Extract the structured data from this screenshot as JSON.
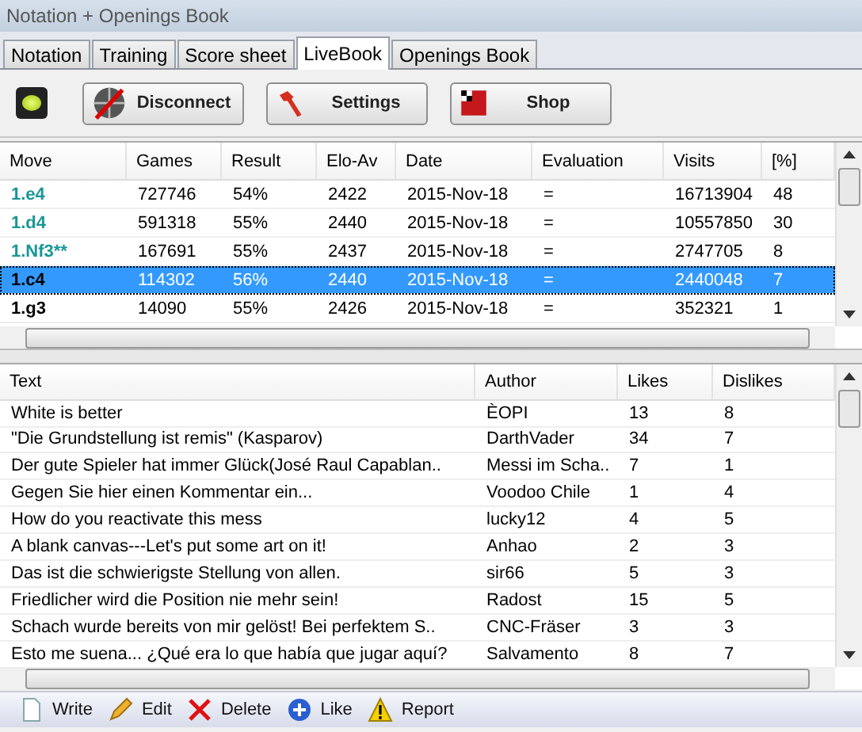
{
  "window": {
    "title": "Notation + Openings Book"
  },
  "tabs": [
    {
      "label": "Notation",
      "selected": false
    },
    {
      "label": "Training",
      "selected": false
    },
    {
      "label": "Score sheet",
      "selected": false
    },
    {
      "label": "LiveBook",
      "selected": true
    },
    {
      "label": "Openings Book",
      "selected": false
    }
  ],
  "toolbar": {
    "connected": true,
    "buttons": [
      {
        "kind": "disconnect",
        "label": "Disconnect"
      },
      {
        "kind": "settings",
        "label": "Settings"
      },
      {
        "kind": "shop",
        "label": "Shop"
      }
    ]
  },
  "moves_table": {
    "columns": [
      "Move",
      "Games",
      "Result",
      "Elo-Av",
      "Date",
      "Evaluation",
      "Visits",
      "[%]"
    ],
    "rows": [
      {
        "cells": [
          "1.e4",
          "727746",
          "54%",
          "2422",
          "2015-Nov-18",
          "=",
          "16713904",
          "48"
        ],
        "color": "#1a9696",
        "selected": false
      },
      {
        "cells": [
          "1.d4",
          "591318",
          "55%",
          "2440",
          "2015-Nov-18",
          "=",
          "10557850",
          "30"
        ],
        "color": "#1a9696",
        "selected": false
      },
      {
        "cells": [
          "1.Nf3**",
          "167691",
          "55%",
          "2437",
          "2015-Nov-18",
          "=",
          "2747705",
          "8"
        ],
        "color": "#1a9696",
        "selected": false
      },
      {
        "cells": [
          "1.c4",
          "114302",
          "56%",
          "2440",
          "2015-Nov-18",
          "=",
          "2440048",
          "7"
        ],
        "color": "#000000",
        "selected": true
      },
      {
        "cells": [
          "1.g3",
          "14090",
          "55%",
          "2426",
          "2015-Nov-18",
          "=",
          "352321",
          "1"
        ],
        "color": "#000000",
        "selected": false
      }
    ]
  },
  "comments_table": {
    "columns": [
      "Text",
      "Author",
      "Likes",
      "Dislikes"
    ],
    "rows": [
      [
        "White is better",
        "ÈOPI",
        "13",
        "8"
      ],
      [
        "\"Die Grundstellung ist remis\" (Kasparov)",
        "DarthVader",
        "34",
        "7"
      ],
      [
        "Der gute Spieler hat immer Glück(José Raul Capablan..",
        "Messi im Scha..",
        "7",
        "1"
      ],
      [
        "Gegen Sie hier einen Kommentar ein...",
        "Voodoo Chile",
        "1",
        "4"
      ],
      [
        "How do you reactivate this mess",
        "lucky12",
        "4",
        "5"
      ],
      [
        "A blank canvas---Let's put some art on it!",
        "Anhao",
        "2",
        "3"
      ],
      [
        "Das ist die schwierigste Stellung von allen.",
        "sir66",
        "5",
        "3"
      ],
      [
        "Friedlicher wird die Position nie mehr sein!",
        "Radost",
        "15",
        "5"
      ],
      [
        "Schach wurde bereits von mir gelöst! Bei perfektem S..",
        "CNC-Fräser",
        "3",
        "3"
      ],
      [
        "Esto me suena... ¿Qué era lo que había que jugar aquí?",
        "Salvamento",
        "8",
        "7"
      ]
    ]
  },
  "bottom_toolbar": [
    {
      "kind": "write",
      "label": "Write"
    },
    {
      "kind": "edit",
      "label": "Edit"
    },
    {
      "kind": "delete",
      "label": "Delete"
    },
    {
      "kind": "like",
      "label": "Like"
    },
    {
      "kind": "report",
      "label": "Report"
    }
  ]
}
